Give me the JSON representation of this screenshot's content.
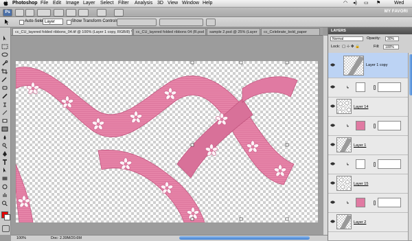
{
  "menubar": {
    "app_name": "Photoshop",
    "items": [
      "File",
      "Edit",
      "Image",
      "Layer",
      "Select",
      "Filter",
      "Analysis",
      "3D",
      "View",
      "Window",
      "Help"
    ],
    "clock": "Wed"
  },
  "appbar": {
    "favorites": "MY FAVORI"
  },
  "options": {
    "auto_select_label": "Auto-Select:",
    "auto_select_value": "Layer",
    "transform_label": "Show Transform Controls"
  },
  "tabs": [
    "cc_CU_layered folded ribbons_04.tif @ 100% (Layer 1 copy, RGB/8) *",
    "cc_CU_layered folded ribbons 04 (R.psd",
    "sample 2.psd @ 25% (Layer",
    "cc_Celebrate_bold_paper"
  ],
  "status": {
    "zoom": "100%",
    "doc": "Doc: 2.39M/20.6M"
  },
  "layers_panel": {
    "title": "LAYERS",
    "blend_mode": "Normal",
    "opacity_label": "Opacity:",
    "opacity_value": "30%",
    "lock_label": "Lock:",
    "fill_label": "Fill:",
    "fill_value": "100%",
    "layers": [
      {
        "name": "Layer 1 copy",
        "selected": true
      },
      {
        "name": "",
        "kind": "adjustment",
        "thumb": "white"
      },
      {
        "name": "Layer 14",
        "kind": "flowers"
      },
      {
        "name": "",
        "kind": "adjustment",
        "thumb": "pink"
      },
      {
        "name": "Layer 1",
        "kind": "ribbon"
      },
      {
        "name": "",
        "kind": "adjustment",
        "thumb": "white"
      },
      {
        "name": "Layer 15",
        "kind": "flowers"
      },
      {
        "name": "",
        "kind": "adjustment",
        "thumb": "pink"
      },
      {
        "name": "Layer 2",
        "kind": "ribbon"
      }
    ]
  },
  "colors": {
    "ribbon": "#e684a8",
    "foreground": "#e60000",
    "selection": "#bcd3f4"
  }
}
